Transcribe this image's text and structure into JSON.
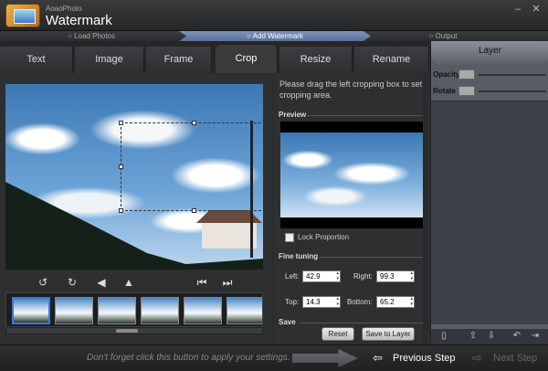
{
  "app": {
    "brand_small": "AoaoPhoto",
    "brand_big": "Watermark"
  },
  "window": {
    "min": "–",
    "close": "✕"
  },
  "steps": [
    {
      "label": "Load Photos",
      "active": false
    },
    {
      "label": "Add Watermark",
      "active": true
    },
    {
      "label": "Output",
      "active": false
    }
  ],
  "tabs": [
    {
      "label": "Text"
    },
    {
      "label": "Image"
    },
    {
      "label": "Frame"
    },
    {
      "label": "Crop"
    },
    {
      "label": "Resize"
    },
    {
      "label": "Rename"
    }
  ],
  "active_tab": "Crop",
  "crop": {
    "hint": "Please drag the left cropping box to set cropping area.",
    "preview_label": "Preview",
    "lock_label": "Lock Proportion",
    "fine_tuning_label": "Fine tuning",
    "left_label": "Left:",
    "left_value": "42.9",
    "right_label": "Right:",
    "right_value": "99.3",
    "top_label": "Top:",
    "top_value": "14.3",
    "bottom_label": "Bottom:",
    "bottom_value": "65.2",
    "save_label": "Save",
    "reset_button": "Reset",
    "save_to_layer_button": "Save to Layer"
  },
  "layer": {
    "title": "Layer",
    "opacity_label": "Opacity",
    "rotate_label": "Rotate"
  },
  "footer": {
    "tip": "Don't forget click this button to apply your settings.",
    "previous_step": "Previous Step",
    "next_step": "Next Step"
  },
  "icons": {
    "rotate_left": "rotate-left-icon",
    "rotate_right": "rotate-right-icon",
    "flip_h": "flip-horizontal-icon",
    "flip_v": "flip-vertical-icon",
    "prev": "previous-photo-icon",
    "next": "next-photo-icon"
  },
  "colors": {
    "accent_step": "#6b7fa8",
    "selected_thumb": "#3a79e0",
    "layer_panel": "#575c65"
  }
}
